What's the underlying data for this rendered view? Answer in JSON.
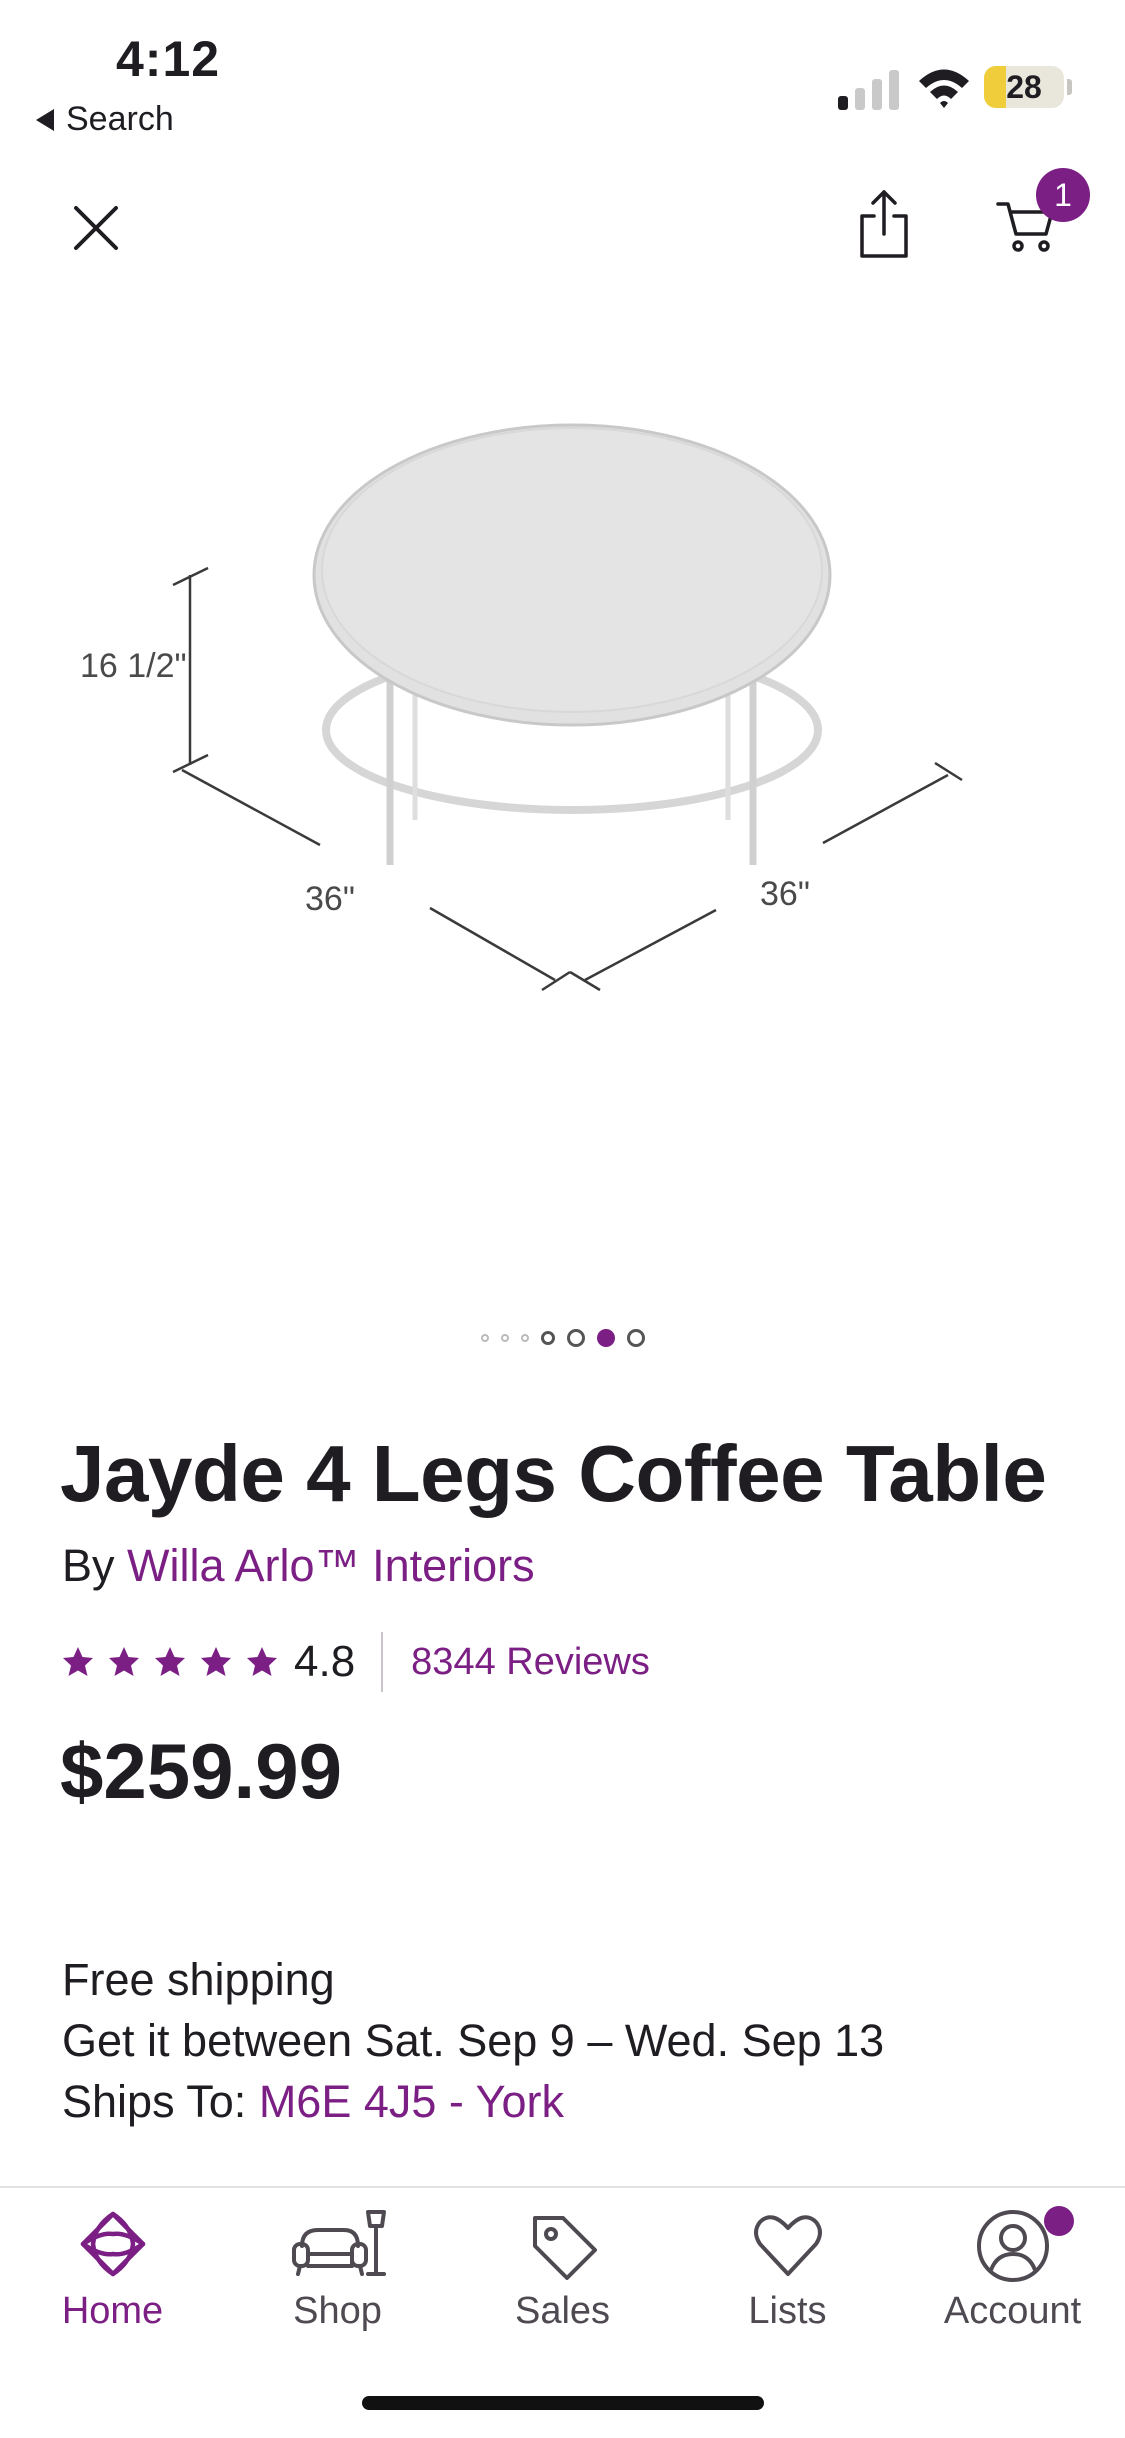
{
  "status_bar": {
    "time": "4:12",
    "back_label": "Search",
    "battery_level": "28",
    "battery_fraction": 0.28,
    "battery_color": "#f0cd3a",
    "signal_bars_active": 1,
    "signal_bars_total": 4
  },
  "top_nav": {
    "close_icon": "close-icon",
    "share_icon": "share-icon",
    "cart_icon": "cart-icon",
    "cart_count": "1"
  },
  "product_image": {
    "height_label": "16 1/2\"",
    "width_label": "36\"",
    "depth_label": "36\""
  },
  "pager": {
    "total": 7,
    "active_index": 5
  },
  "product": {
    "title": "Jayde 4 Legs Coffee Table",
    "by_label": "By",
    "brand": "Willa Arlo™ Interiors",
    "rating": "4.8",
    "rating_value": 4.8,
    "stars_total": 5,
    "reviews": "8344 Reviews",
    "price": "$259.99"
  },
  "shipping": {
    "line1": "Free shipping",
    "line2": "Get it between Sat. Sep 9 – Wed. Sep 13",
    "ships_to_label": "Ships To:",
    "ships_to_value": "M6E 4J5 - York"
  },
  "tabs": [
    {
      "label": "Home",
      "icon": "home-icon",
      "active": true
    },
    {
      "label": "Shop",
      "icon": "sofa-lamp-icon",
      "active": false
    },
    {
      "label": "Sales",
      "icon": "tag-icon",
      "active": false
    },
    {
      "label": "Lists",
      "icon": "heart-icon",
      "active": false
    },
    {
      "label": "Account",
      "icon": "account-icon",
      "active": false
    }
  ],
  "colors": {
    "brand_purple": "#7b1f85",
    "text": "#1f1c22"
  }
}
